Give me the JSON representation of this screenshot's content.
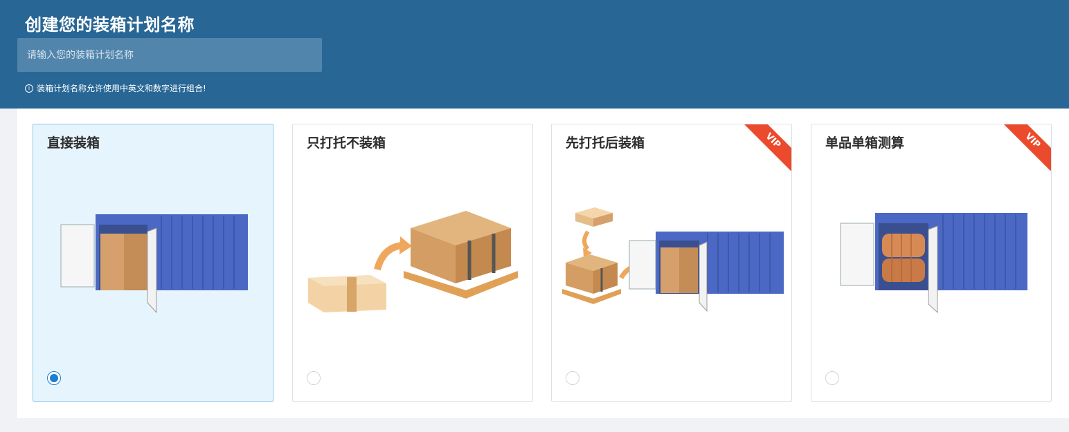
{
  "header": {
    "title": "创建您的装箱计划名称",
    "input_placeholder": "请输入您的装箱计划名称",
    "input_value": "",
    "hint_icon": "info-circle-icon",
    "hint": "装箱计划名称允许使用中英文和数字进行组合!"
  },
  "options": [
    {
      "label": "直接装箱",
      "selected": true,
      "vip": false
    },
    {
      "label": "只打托不装箱",
      "selected": false,
      "vip": false
    },
    {
      "label": "先打托后装箱",
      "selected": false,
      "vip": true,
      "badge": "VIP"
    },
    {
      "label": "单品单箱测算",
      "selected": false,
      "vip": true,
      "badge": "VIP"
    }
  ],
  "colors": {
    "header_bg": "#286695",
    "selected_bg": "#e6f4fd",
    "radio_active": "#1b7fd0",
    "vip_badge": "#ec4a2c",
    "container_blue": "#4a68c4",
    "box_brown": "#d5a06b"
  }
}
